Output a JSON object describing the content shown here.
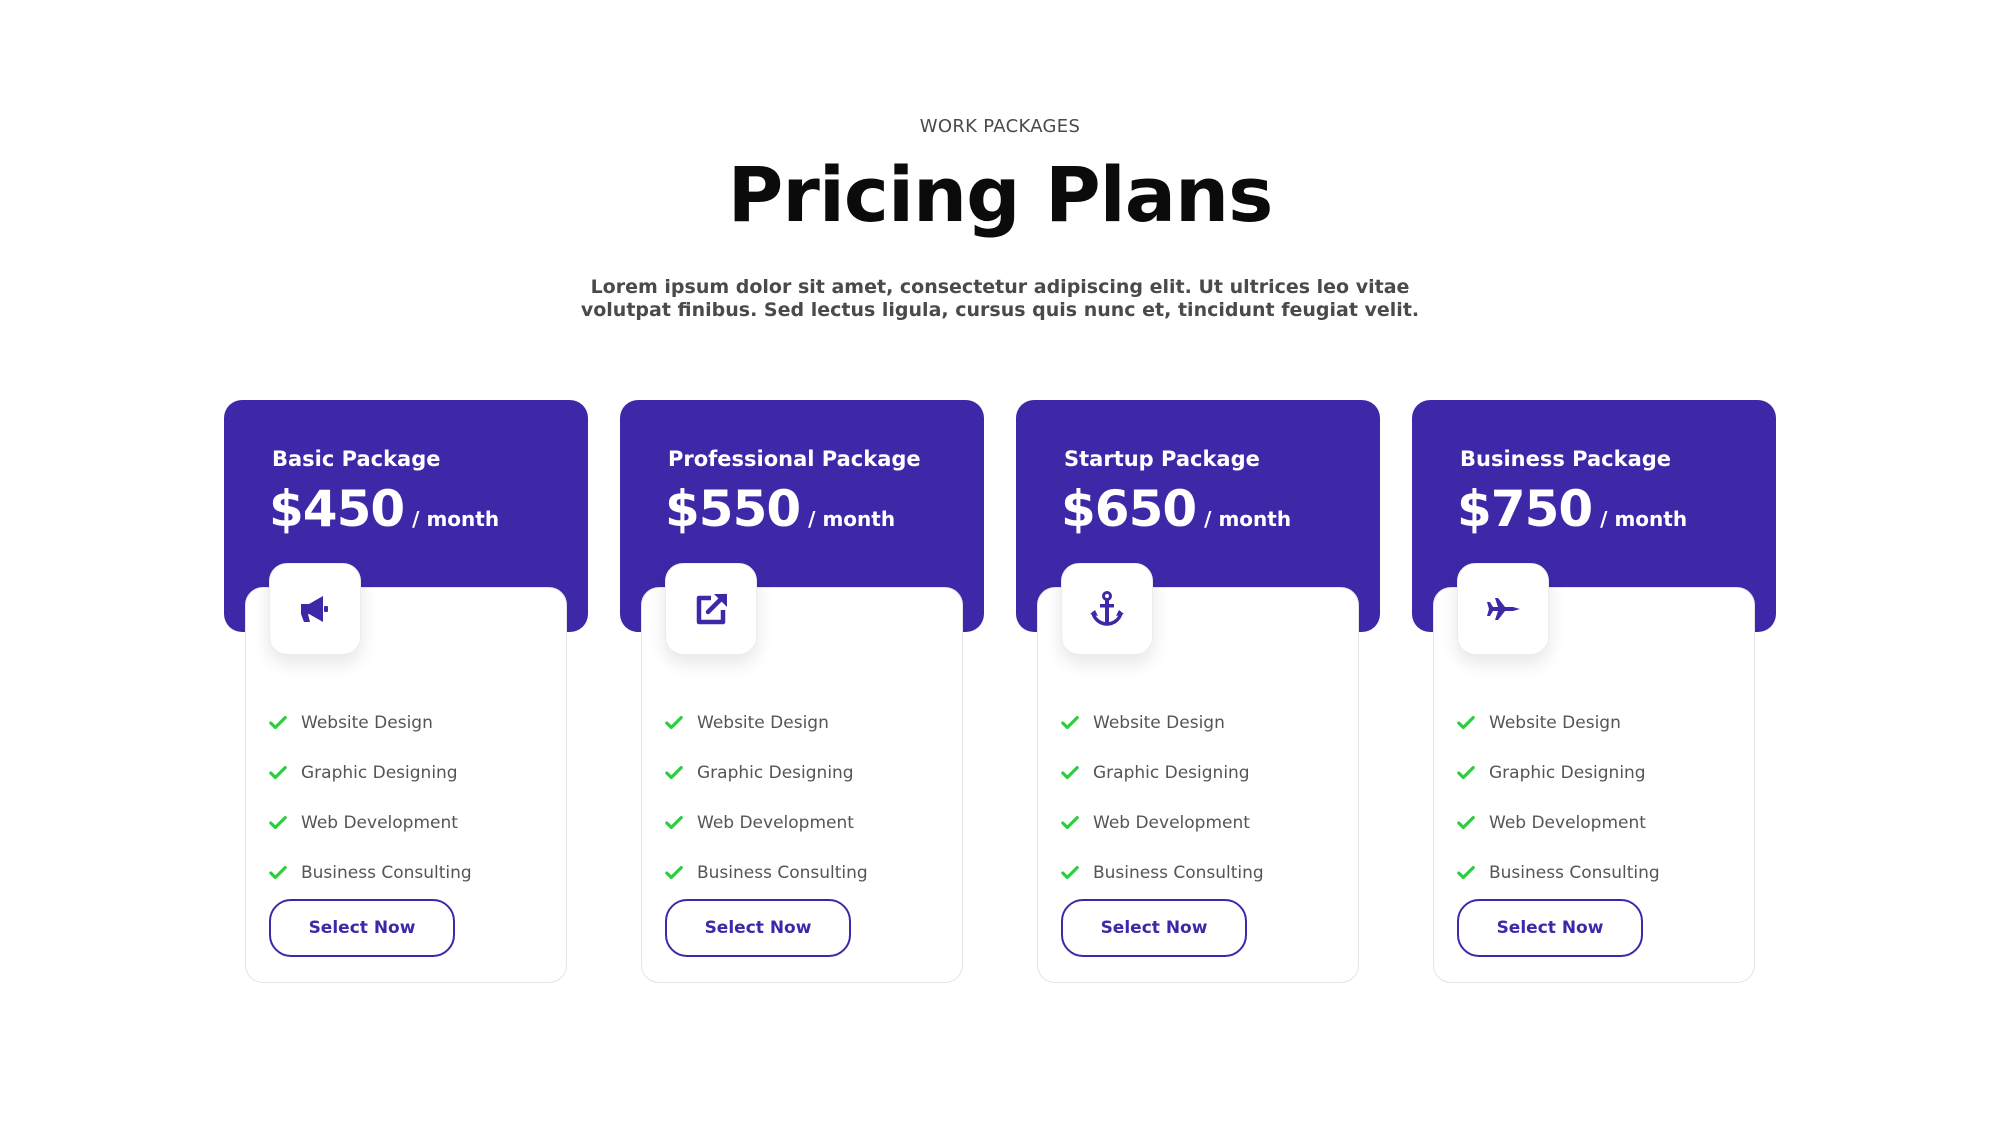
{
  "header": {
    "eyebrow": "WORK PACKAGES",
    "title": "Pricing Plans",
    "subtitle": "Lorem ipsum dolor sit amet, consectetur adipiscing elit. Ut ultrices leo vitae volutpat finibus. Sed lectus ligula, cursus quis nunc et, tincidunt feugiat velit."
  },
  "colors": {
    "accent": "#3f28a8",
    "check": "#2ecc40"
  },
  "plans": [
    {
      "name": "Basic Package",
      "price": "$450",
      "period": "/ month",
      "icon": "megaphone-icon",
      "features": [
        "Website Design",
        "Graphic Designing",
        "Web Development",
        "Business Consulting"
      ],
      "button": "Select Now"
    },
    {
      "name": "Professional  Package",
      "price": "$550",
      "period": "/ month",
      "icon": "external-link-icon",
      "features": [
        "Website Design",
        "Graphic Designing",
        "Web Development",
        "Business Consulting"
      ],
      "button": "Select Now"
    },
    {
      "name": "Startup Package",
      "price": "$650",
      "period": "/ month",
      "icon": "anchor-icon",
      "features": [
        "Website Design",
        "Graphic Designing",
        "Web Development",
        "Business Consulting"
      ],
      "button": "Select Now"
    },
    {
      "name": "Business Package",
      "price": "$750",
      "period": "/ month",
      "icon": "fighter-jet-icon",
      "features": [
        "Website Design",
        "Graphic Designing",
        "Web Development",
        "Business Consulting"
      ],
      "button": "Select Now"
    }
  ]
}
